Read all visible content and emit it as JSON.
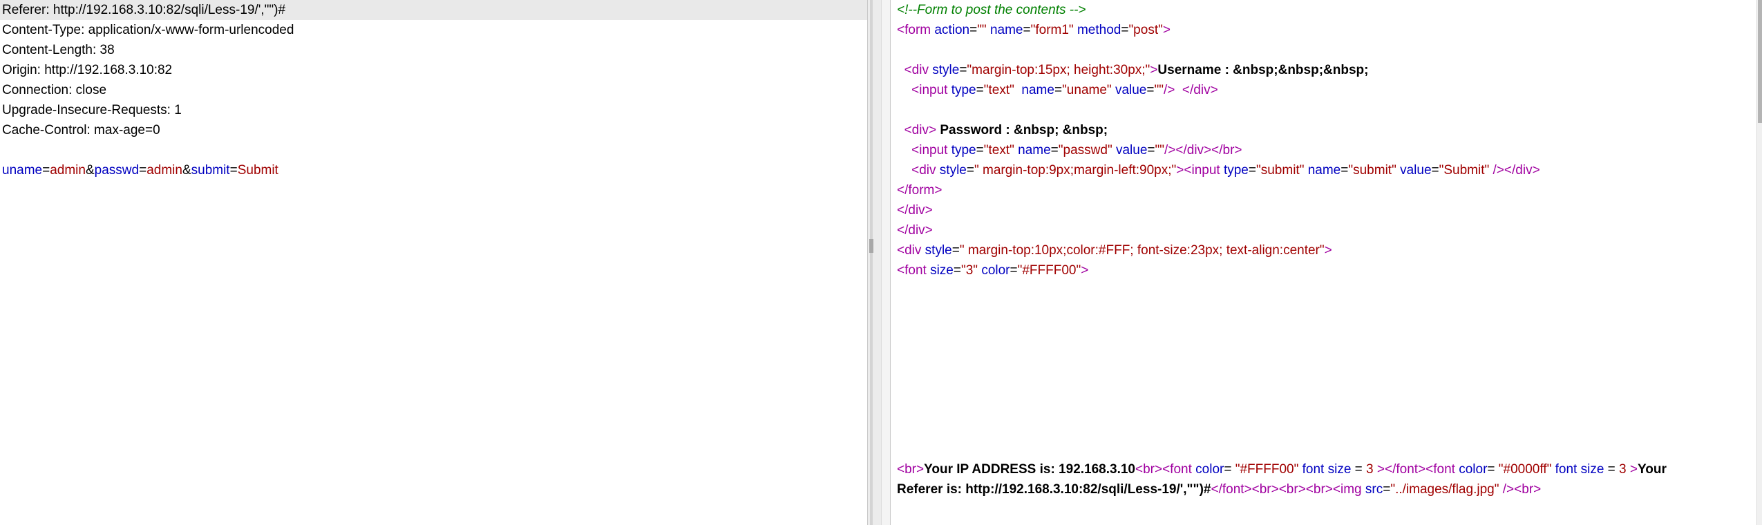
{
  "request": {
    "headers": [
      "Referer: http://192.168.3.10:82/sqli/Less-19/',\"\")#",
      "Content-Type: application/x-www-form-urlencoded",
      "Content-Length: 38",
      "Origin: http://192.168.3.10:82",
      "Connection: close",
      "Upgrade-Insecure-Requests: 1",
      "Cache-Control: max-age=0"
    ],
    "body_params": [
      {
        "key": "uname",
        "value": "admin"
      },
      {
        "key": "passwd",
        "value": "admin"
      },
      {
        "key": "submit",
        "value": "Submit"
      }
    ]
  },
  "response": {
    "lines": [
      [
        {
          "t": "cmt",
          "v": "<!--Form to post the contents -->"
        }
      ],
      [
        {
          "t": "tag",
          "v": "<form "
        },
        {
          "t": "attr",
          "v": "action"
        },
        {
          "t": "plain",
          "v": "="
        },
        {
          "t": "str",
          "v": "\"\""
        },
        {
          "t": "plain",
          "v": " "
        },
        {
          "t": "attr",
          "v": "name"
        },
        {
          "t": "plain",
          "v": "="
        },
        {
          "t": "str",
          "v": "\"form1\""
        },
        {
          "t": "plain",
          "v": " "
        },
        {
          "t": "attr",
          "v": "method"
        },
        {
          "t": "plain",
          "v": "="
        },
        {
          "t": "str",
          "v": "\"post\""
        },
        {
          "t": "tag",
          "v": ">"
        }
      ],
      [],
      [
        {
          "t": "plain",
          "v": "  "
        },
        {
          "t": "tag",
          "v": "<div "
        },
        {
          "t": "attr",
          "v": "style"
        },
        {
          "t": "plain",
          "v": "="
        },
        {
          "t": "str",
          "v": "\"margin-top:15px; height:30px;\""
        },
        {
          "t": "tag",
          "v": ">"
        },
        {
          "t": "txt",
          "v": "Username : &nbsp;&nbsp;&nbsp;"
        }
      ],
      [
        {
          "t": "plain",
          "v": "    "
        },
        {
          "t": "tag",
          "v": "<input "
        },
        {
          "t": "attr",
          "v": "type"
        },
        {
          "t": "plain",
          "v": "="
        },
        {
          "t": "str",
          "v": "\"text\""
        },
        {
          "t": "plain",
          "v": "  "
        },
        {
          "t": "attr",
          "v": "name"
        },
        {
          "t": "plain",
          "v": "="
        },
        {
          "t": "str",
          "v": "\"uname\""
        },
        {
          "t": "plain",
          "v": " "
        },
        {
          "t": "attr",
          "v": "value"
        },
        {
          "t": "plain",
          "v": "="
        },
        {
          "t": "str",
          "v": "\"\""
        },
        {
          "t": "tag",
          "v": "/>"
        },
        {
          "t": "plain",
          "v": "  "
        },
        {
          "t": "tag",
          "v": "</div>"
        }
      ],
      [],
      [
        {
          "t": "plain",
          "v": "  "
        },
        {
          "t": "tag",
          "v": "<div>"
        },
        {
          "t": "txt",
          "v": " Password : &nbsp; &nbsp;"
        }
      ],
      [
        {
          "t": "plain",
          "v": "    "
        },
        {
          "t": "tag",
          "v": "<input "
        },
        {
          "t": "attr",
          "v": "type"
        },
        {
          "t": "plain",
          "v": "="
        },
        {
          "t": "str",
          "v": "\"text\""
        },
        {
          "t": "plain",
          "v": " "
        },
        {
          "t": "attr",
          "v": "name"
        },
        {
          "t": "plain",
          "v": "="
        },
        {
          "t": "str",
          "v": "\"passwd\""
        },
        {
          "t": "plain",
          "v": " "
        },
        {
          "t": "attr",
          "v": "value"
        },
        {
          "t": "plain",
          "v": "="
        },
        {
          "t": "str",
          "v": "\"\""
        },
        {
          "t": "tag",
          "v": "/></div></br>"
        }
      ],
      [
        {
          "t": "plain",
          "v": "    "
        },
        {
          "t": "tag",
          "v": "<div "
        },
        {
          "t": "attr",
          "v": "style"
        },
        {
          "t": "plain",
          "v": "="
        },
        {
          "t": "str",
          "v": "\" margin-top:9px;margin-left:90px;\""
        },
        {
          "t": "tag",
          "v": "><input "
        },
        {
          "t": "attr",
          "v": "type"
        },
        {
          "t": "plain",
          "v": "="
        },
        {
          "t": "str",
          "v": "\"submit\""
        },
        {
          "t": "plain",
          "v": " "
        },
        {
          "t": "attr",
          "v": "name"
        },
        {
          "t": "plain",
          "v": "="
        },
        {
          "t": "str",
          "v": "\"submit\""
        },
        {
          "t": "plain",
          "v": " "
        },
        {
          "t": "attr",
          "v": "value"
        },
        {
          "t": "plain",
          "v": "="
        },
        {
          "t": "str",
          "v": "\"Submit\""
        },
        {
          "t": "plain",
          "v": " "
        },
        {
          "t": "tag",
          "v": "/></div>"
        }
      ],
      [
        {
          "t": "tag",
          "v": "</form>"
        }
      ],
      [
        {
          "t": "tag",
          "v": "</div>"
        }
      ],
      [
        {
          "t": "tag",
          "v": "</div>"
        }
      ],
      [
        {
          "t": "tag",
          "v": "<div "
        },
        {
          "t": "attr",
          "v": "style"
        },
        {
          "t": "plain",
          "v": "="
        },
        {
          "t": "str",
          "v": "\" margin-top:10px;color:#FFF; font-size:23px; text-align:center\""
        },
        {
          "t": "tag",
          "v": ">"
        }
      ],
      [
        {
          "t": "tag",
          "v": "<font "
        },
        {
          "t": "attr",
          "v": "size"
        },
        {
          "t": "plain",
          "v": "="
        },
        {
          "t": "str",
          "v": "\"3\""
        },
        {
          "t": "plain",
          "v": " "
        },
        {
          "t": "attr",
          "v": "color"
        },
        {
          "t": "plain",
          "v": "="
        },
        {
          "t": "str",
          "v": "\"#FFFF00\""
        },
        {
          "t": "tag",
          "v": ">"
        }
      ]
    ],
    "lower_lines": [
      [
        {
          "t": "tag",
          "v": "<br>"
        },
        {
          "t": "txt",
          "v": "Your IP ADDRESS is: 192.168.3.10"
        },
        {
          "t": "tag",
          "v": "<br><font "
        },
        {
          "t": "attr",
          "v": "color"
        },
        {
          "t": "plain",
          "v": "= "
        },
        {
          "t": "str",
          "v": "\"#FFFF00\""
        },
        {
          "t": "plain",
          "v": " "
        },
        {
          "t": "attr",
          "v": "font size"
        },
        {
          "t": "plain",
          "v": " = "
        },
        {
          "t": "str",
          "v": "3"
        },
        {
          "t": "plain",
          "v": " "
        },
        {
          "t": "tag",
          "v": "></font><font "
        },
        {
          "t": "attr",
          "v": "color"
        },
        {
          "t": "plain",
          "v": "= "
        },
        {
          "t": "str",
          "v": "\"#0000ff\""
        },
        {
          "t": "plain",
          "v": " "
        },
        {
          "t": "attr",
          "v": "font size"
        },
        {
          "t": "plain",
          "v": " = "
        },
        {
          "t": "str",
          "v": "3"
        },
        {
          "t": "plain",
          "v": " "
        },
        {
          "t": "tag",
          "v": ">"
        },
        {
          "t": "txt",
          "v": "Your"
        }
      ],
      [
        {
          "t": "txt",
          "v": "Referer is: http://192.168.3.10:82/sqli/Less-19/',\"\")#"
        },
        {
          "t": "tag",
          "v": "</font><br><br><br><img "
        },
        {
          "t": "attr",
          "v": "src"
        },
        {
          "t": "plain",
          "v": "="
        },
        {
          "t": "str",
          "v": "\"../images/flag.jpg\""
        },
        {
          "t": "plain",
          "v": " "
        },
        {
          "t": "tag",
          "v": "/><br>"
        }
      ]
    ]
  },
  "colors": {
    "tag": "#a000a0",
    "attribute": "#0000c0",
    "string": "#a00000",
    "comment": "#008000",
    "text": "#000000",
    "param_key": "#0000c0",
    "param_value": "#a00000"
  }
}
